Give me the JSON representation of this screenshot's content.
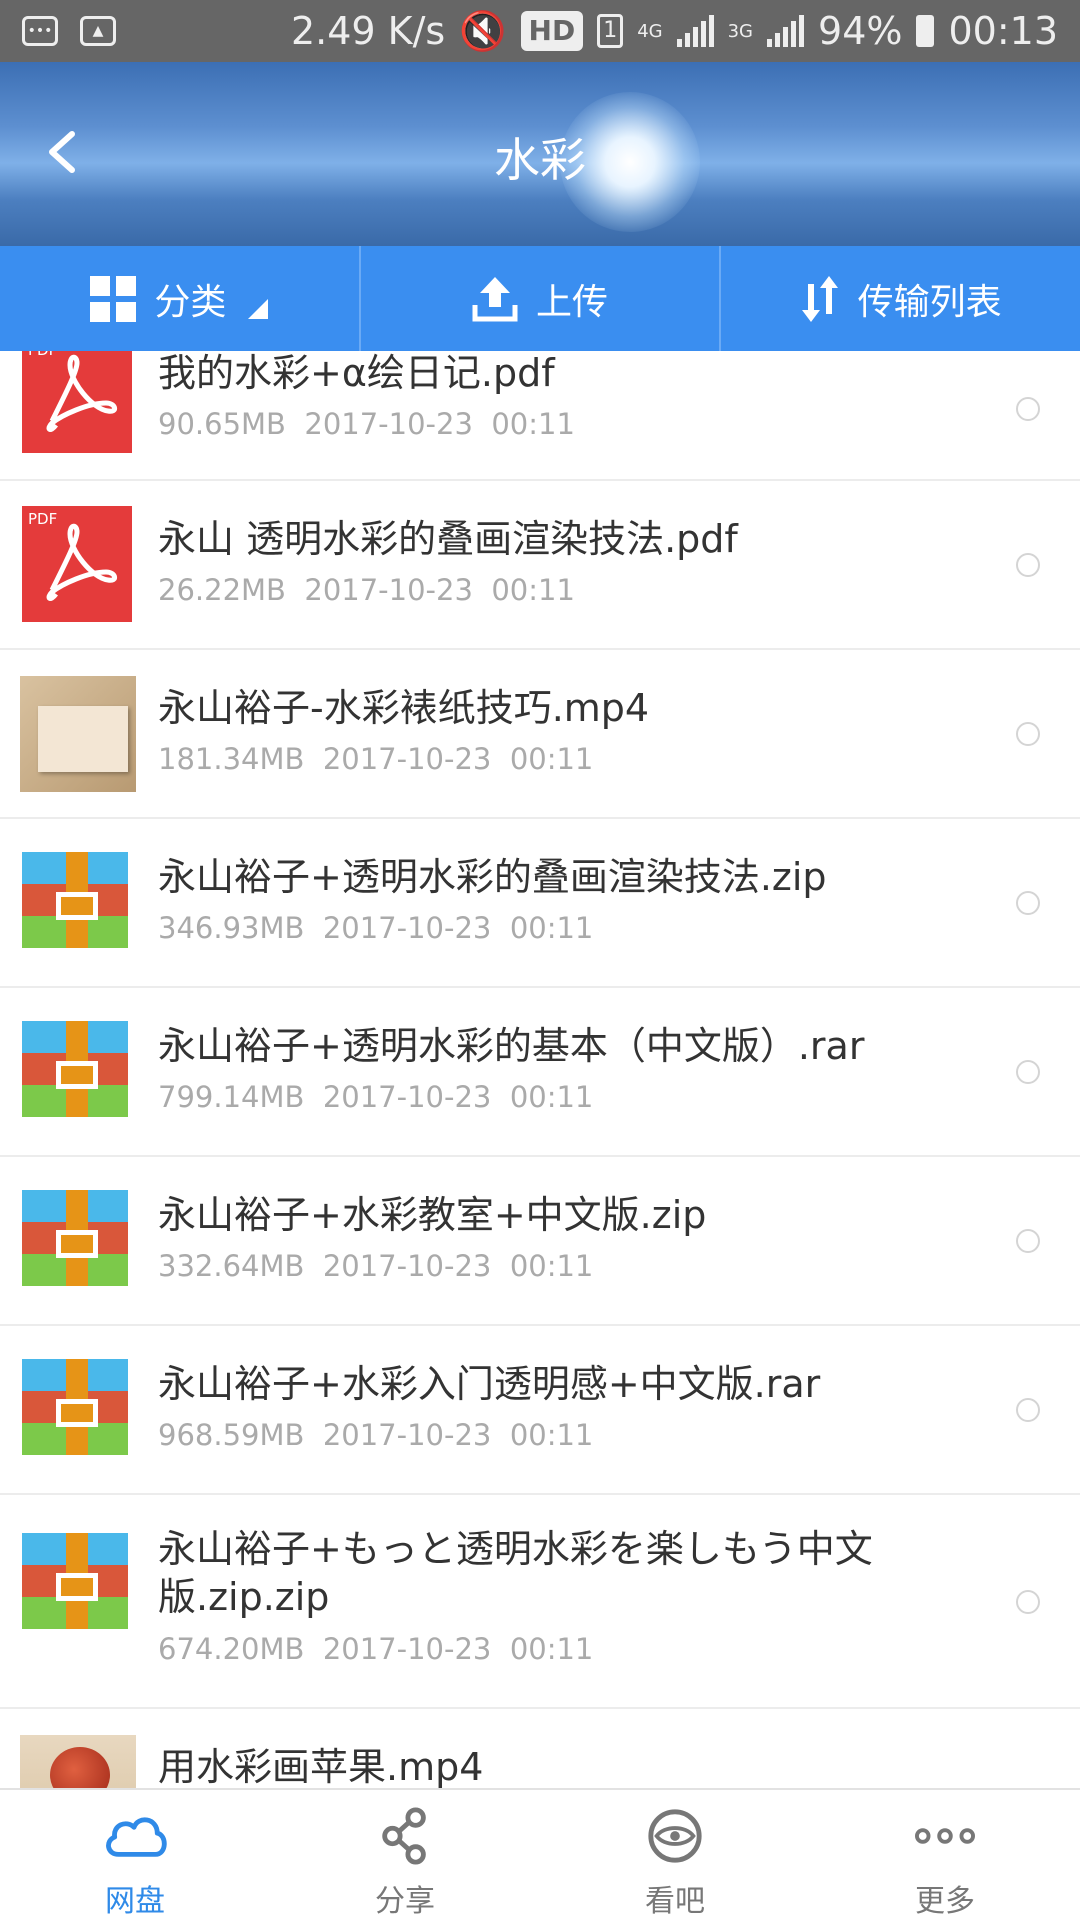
{
  "status_bar": {
    "speed": "2.49 K/s",
    "hd": "HD",
    "sim": "1",
    "net1": "4G",
    "net2": "3G",
    "battery": "94%",
    "time": "00:13"
  },
  "header": {
    "title": "水彩"
  },
  "toolbar": {
    "category_label": "分类",
    "upload_label": "上传",
    "transfer_label": "传输列表"
  },
  "files": [
    {
      "name": "我的水彩+α绘日记.pdf",
      "size": "90.65MB",
      "date": "2017-10-23",
      "time": "00:11",
      "type": "pdf"
    },
    {
      "name": "永山 透明水彩的叠画渲染技法.pdf",
      "size": "26.22MB",
      "date": "2017-10-23",
      "time": "00:11",
      "type": "pdf"
    },
    {
      "name": "永山裕子-水彩裱纸技巧.mp4",
      "size": "181.34MB",
      "date": "2017-10-23",
      "time": "00:11",
      "type": "video"
    },
    {
      "name": "永山裕子+透明水彩的叠画渲染技法.zip",
      "size": "346.93MB",
      "date": "2017-10-23",
      "time": "00:11",
      "type": "zip"
    },
    {
      "name": "永山裕子+透明水彩的基本（中文版）.rar",
      "size": "799.14MB",
      "date": "2017-10-23",
      "time": "00:11",
      "type": "zip"
    },
    {
      "name": "永山裕子+水彩教室+中文版.zip",
      "size": "332.64MB",
      "date": "2017-10-23",
      "time": "00:11",
      "type": "zip"
    },
    {
      "name": "永山裕子+水彩入门透明感+中文版.rar",
      "size": "968.59MB",
      "date": "2017-10-23",
      "time": "00:11",
      "type": "zip"
    },
    {
      "name": "永山裕子+もっと透明水彩を楽しもう中文版.zip.zip",
      "size": "674.20MB",
      "date": "2017-10-23",
      "time": "00:11",
      "type": "zip"
    },
    {
      "name": "用水彩画苹果.mp4",
      "size": "",
      "date": "",
      "time": "",
      "type": "video"
    }
  ],
  "bottom_nav": {
    "items": [
      {
        "label": "网盘",
        "icon": "cloud-icon",
        "active": true
      },
      {
        "label": "分享",
        "icon": "share-icon",
        "active": false
      },
      {
        "label": "看吧",
        "icon": "eye-icon",
        "active": false
      },
      {
        "label": "更多",
        "icon": "more-icon",
        "active": false
      }
    ]
  },
  "colors": {
    "accent": "#3a8ef0",
    "active_nav": "#2f8ae8",
    "pdf": "#e43b3b"
  }
}
